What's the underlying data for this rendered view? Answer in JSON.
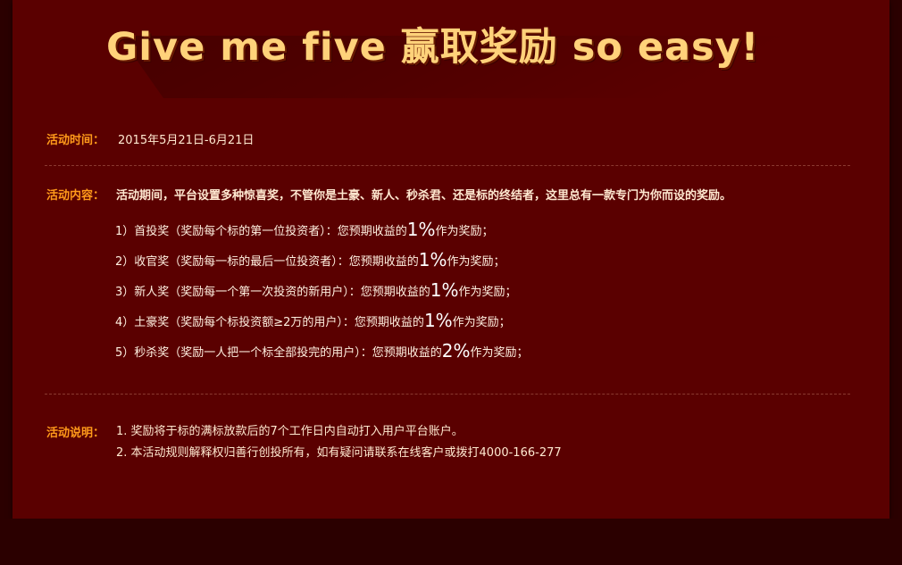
{
  "hero": {
    "title": "Give me five 赢取奖励 so easy!"
  },
  "activity_time": {
    "label": "活动时间：",
    "value": "2015年5月21日-6月21日"
  },
  "activity_content": {
    "label": "活动内容：",
    "value": "活动期间，平台设置多种惊喜奖，不管你是土豪、新人、秒杀君、还是标的终结者，这里总有一款专门为你而设的奖励。",
    "awards": [
      {
        "prefix": "1）首投奖（奖励每个标的第一位投资者）：您预期收益的",
        "pct": "1%",
        "suffix": "作为奖励；"
      },
      {
        "prefix": "2）收官奖（奖励每一标的最后一位投资者）：您预期收益的",
        "pct": "1%",
        "suffix": "作为奖励；"
      },
      {
        "prefix": "3）新人奖（奖励每一个第一次投资的新用户）：您预期收益的",
        "pct": "1%",
        "suffix": "作为奖励；"
      },
      {
        "prefix": "4）土豪奖（奖励每个标投资额≥2万的用户）：您预期收益的",
        "pct": "1%",
        "suffix": "作为奖励；"
      },
      {
        "prefix": "5）秒杀奖（奖励一人把一个标全部投完的用户）：您预期收益的",
        "pct": "2%",
        "suffix": "作为奖励；"
      }
    ]
  },
  "activity_notes": {
    "label": "活动说明：",
    "items": [
      "1. 奖励将于标的满标放款后的7个工作日内自动打入用户平台账户。",
      "2. 本活动规则解释权归善行创投所有，如有疑问请联系在线客户或拨打4000-166-277"
    ]
  },
  "colors": {
    "page_bg": "#2b0000",
    "panel_bg": "#5a0000",
    "label": "#ff9a1a",
    "title": "#ffd27a",
    "text": "#ffe9d0"
  }
}
